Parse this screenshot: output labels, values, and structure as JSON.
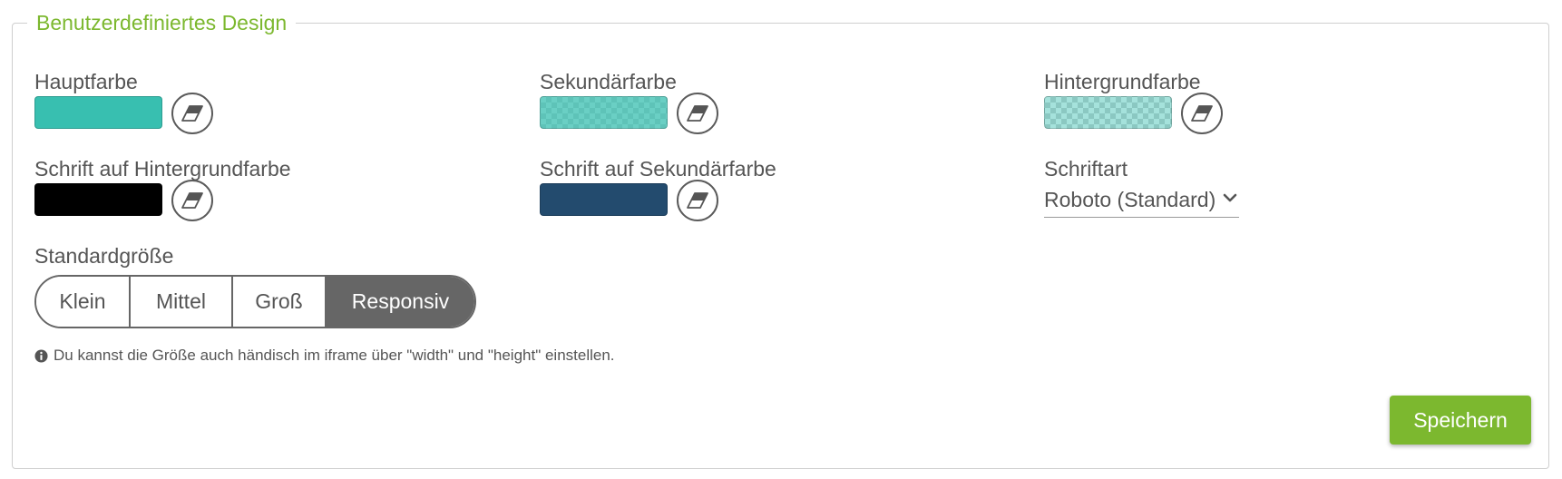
{
  "section": {
    "title": "Benutzerdefiniertes Design"
  },
  "colors": {
    "main": {
      "label": "Hauptfarbe",
      "value": "#38bfb0",
      "pattern": "solid"
    },
    "secondary": {
      "label": "Sekundärfarbe",
      "value": "#38bfb0",
      "pattern": "semi-transparent"
    },
    "background": {
      "label": "Hintergrundfarbe",
      "value": "#38bfb0",
      "pattern": "mostly-transparent"
    },
    "text_on_background": {
      "label": "Schrift auf Hintergrundfarbe",
      "value": "#000000",
      "pattern": "solid"
    },
    "text_on_secondary": {
      "label": "Schrift auf Sekundärfarbe",
      "value": "#234b6e",
      "pattern": "solid"
    }
  },
  "font": {
    "label": "Schriftart",
    "value": "Roboto (Standard)"
  },
  "size": {
    "label": "Standardgröße",
    "options": [
      "Klein",
      "Mittel",
      "Groß",
      "Responsiv"
    ],
    "selected": "Responsiv"
  },
  "hint": {
    "icon": "info-circle-icon",
    "text": "Du kannst die Größe auch händisch im iframe über \"width\" und \"height\" einstellen."
  },
  "save_button": {
    "label": "Speichern",
    "color": "#7cb82f"
  },
  "theme": {
    "accent": "#7cb82f",
    "border": "#cfcfcf",
    "control_dark": "#666666"
  }
}
